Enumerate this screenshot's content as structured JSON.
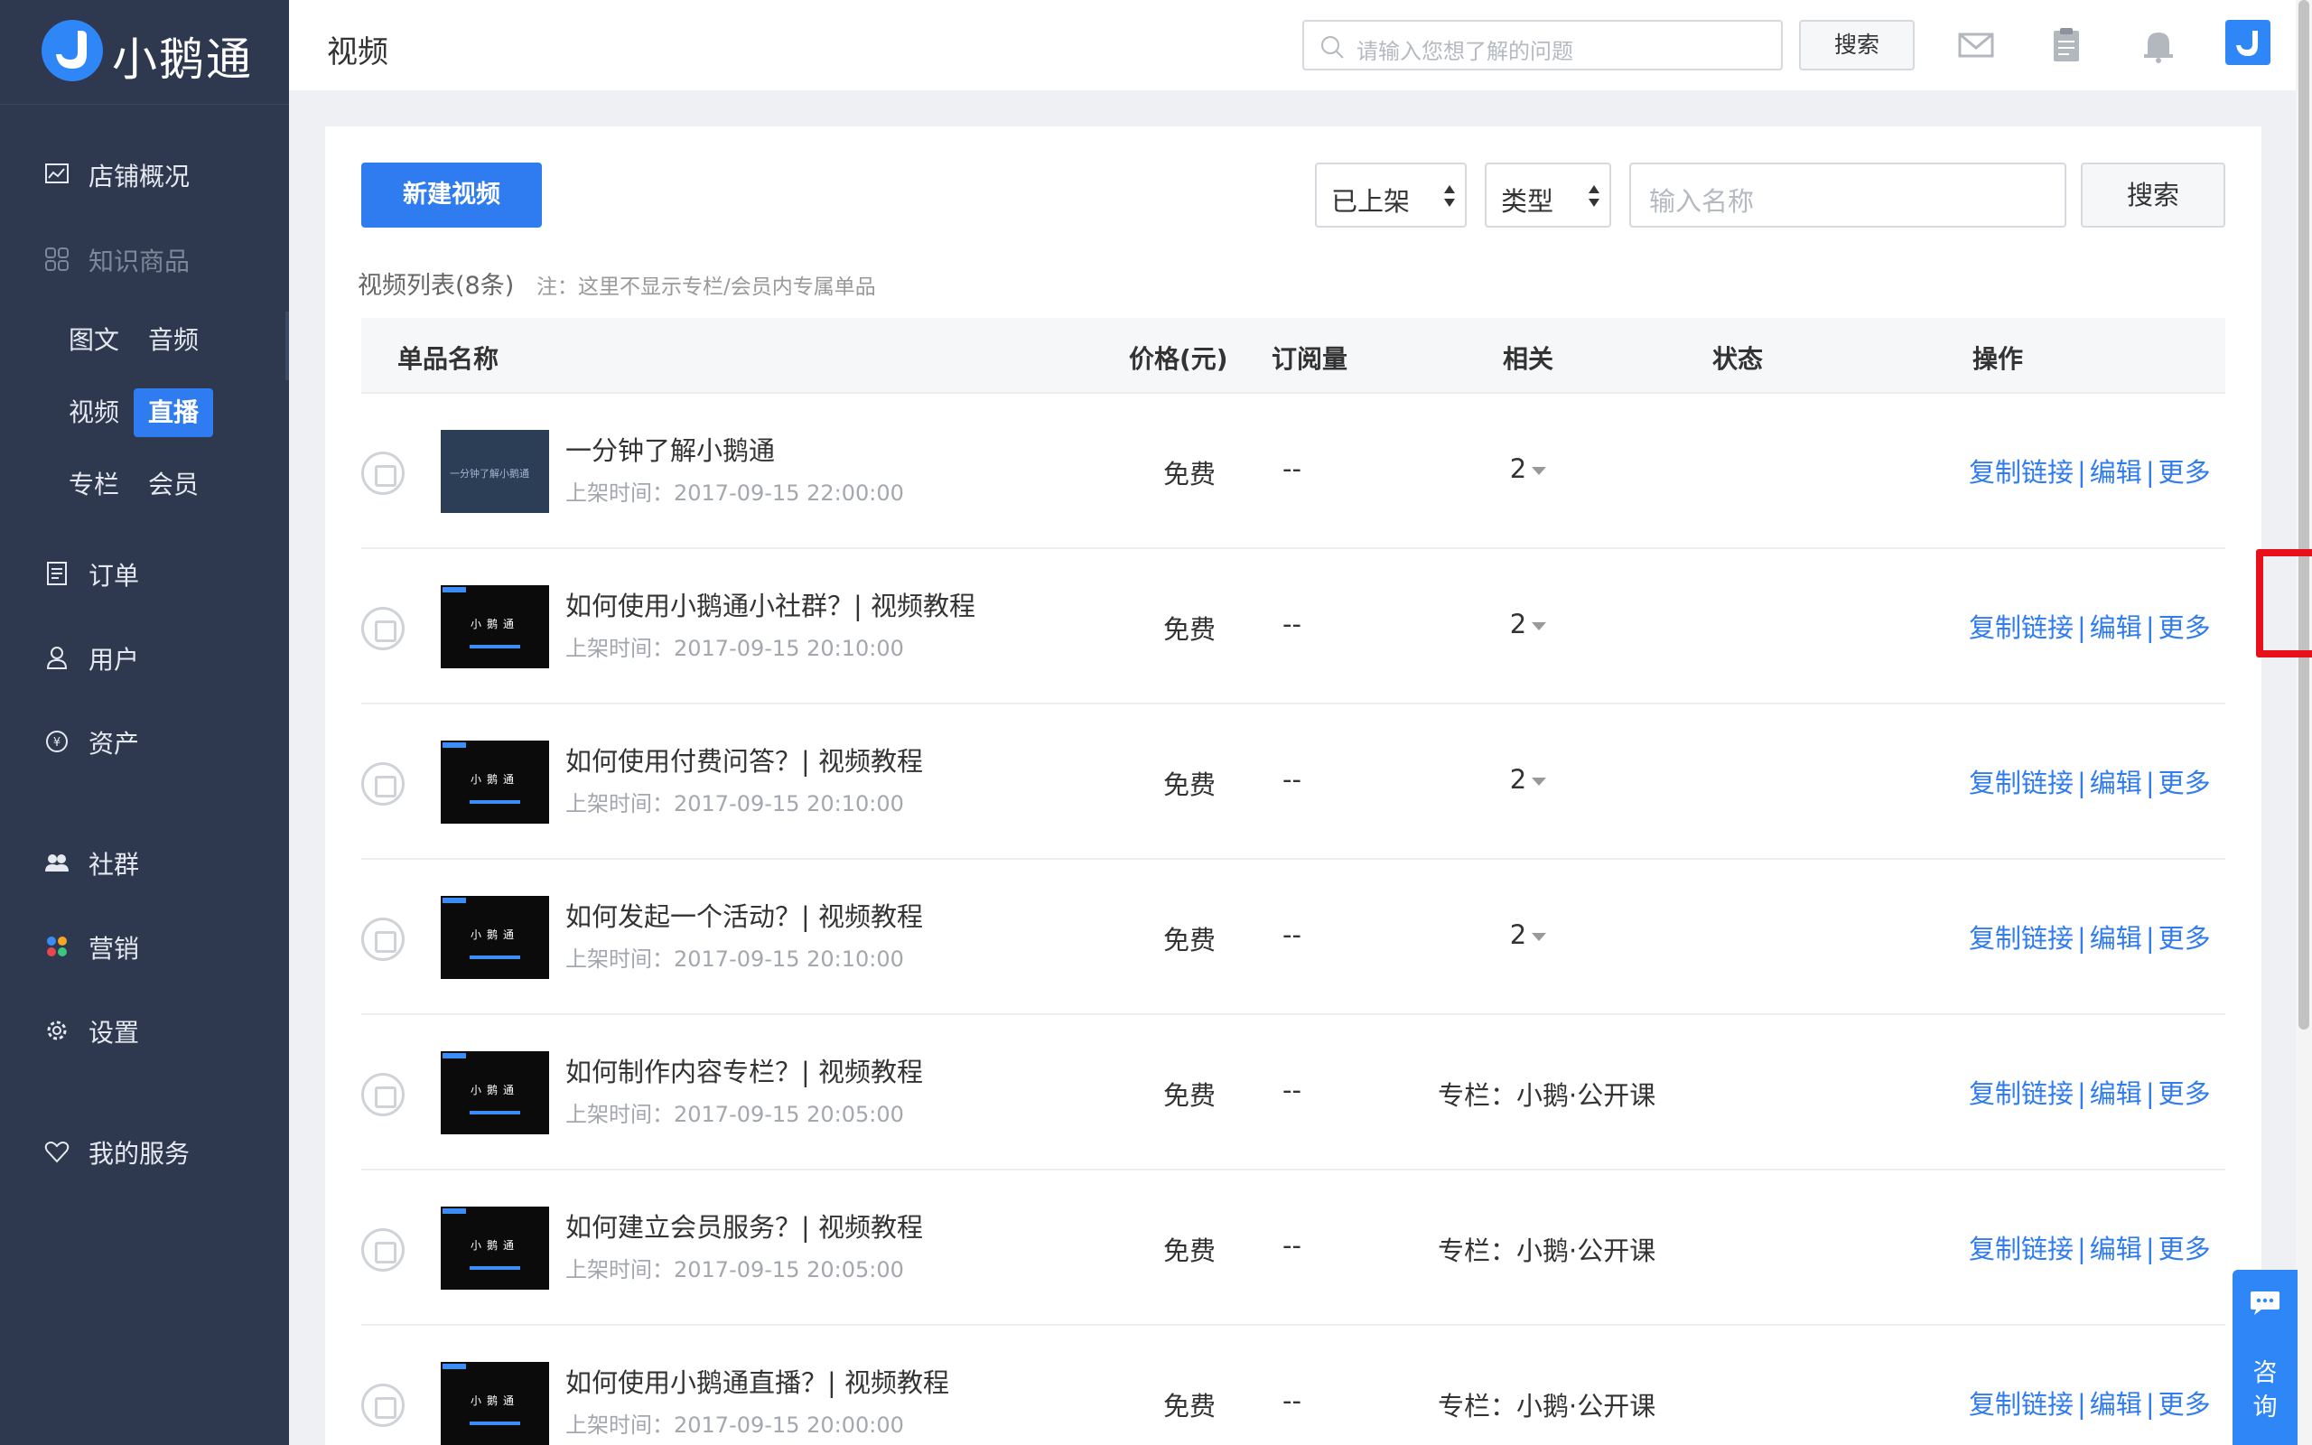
{
  "brand": {
    "name": "小鹅通"
  },
  "sidebar": {
    "overview": "店铺概况",
    "knowledge": "知识商品",
    "sub": {
      "article": "图文",
      "audio": "音频",
      "video": "视频",
      "live": "直播",
      "column": "专栏",
      "member": "会员"
    },
    "orders": "订单",
    "users": "用户",
    "assets": "资产",
    "community": "社群",
    "marketing": "营销",
    "settings": "设置",
    "services": "我的服务"
  },
  "header": {
    "title": "视频",
    "search_placeholder": "请输入您想了解的问题",
    "search_button": "搜索"
  },
  "toolbar": {
    "new_button": "新建视频",
    "status_select": "已上架",
    "type_select": "类型",
    "name_placeholder": "输入名称",
    "search_button": "搜索"
  },
  "list": {
    "title": "视频列表(8条)",
    "note": "注：这里不显示专栏/会员内专属单品",
    "columns": {
      "name": "单品名称",
      "price": "价格(元)",
      "subs": "订阅量",
      "related": "相关",
      "status": "状态",
      "ops": "操作"
    },
    "rows": [
      {
        "title": "一分钟了解小鹅通",
        "time": "上架时间：2017-09-15 22:00:00",
        "price": "免费",
        "subs": "--",
        "related": "2",
        "dropdown": true
      },
      {
        "title": "如何使用小鹅通小社群？| 视频教程",
        "time": "上架时间：2017-09-15 20:10:00",
        "price": "免费",
        "subs": "--",
        "related": "2",
        "dropdown": true
      },
      {
        "title": "如何使用付费问答？| 视频教程",
        "time": "上架时间：2017-09-15 20:10:00",
        "price": "免费",
        "subs": "--",
        "related": "2",
        "dropdown": true
      },
      {
        "title": "如何发起一个活动？| 视频教程",
        "time": "上架时间：2017-09-15 20:10:00",
        "price": "免费",
        "subs": "--",
        "related": "2",
        "dropdown": true
      },
      {
        "title": "如何制作内容专栏？| 视频教程",
        "time": "上架时间：2017-09-15 20:05:00",
        "price": "免费",
        "subs": "--",
        "related": "专栏：小鹅·公开课",
        "dropdown": false
      },
      {
        "title": "如何建立会员服务？| 视频教程",
        "time": "上架时间：2017-09-15 20:05:00",
        "price": "免费",
        "subs": "--",
        "related": "专栏：小鹅·公开课",
        "dropdown": false
      },
      {
        "title": "如何使用小鹅通直播？| 视频教程",
        "time": "上架时间：2017-09-15 20:00:00",
        "price": "免费",
        "subs": "--",
        "related": "专栏：小鹅·公开课",
        "dropdown": false
      }
    ],
    "ops": {
      "copy": "复制链接",
      "edit": "编辑",
      "more": "更多",
      "sep": "|"
    },
    "thumb": {
      "logo": "小鹅通",
      "first": "一分钟了解小鹅通"
    }
  },
  "consult": {
    "label1": "咨",
    "label2": "询"
  },
  "colors": {
    "sidebar": "#2e3950",
    "accent": "#2f7bf0",
    "highlight": "#e8101a"
  }
}
